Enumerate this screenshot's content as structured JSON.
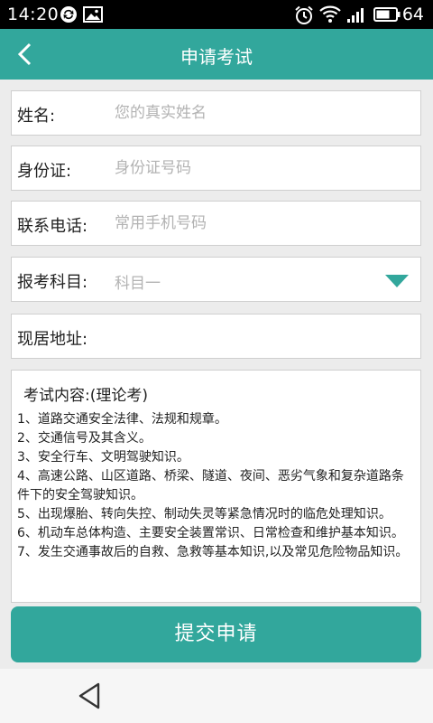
{
  "status_bar": {
    "time": "14:20",
    "battery_percent": "64",
    "icons": [
      "sync-icon",
      "image-icon",
      "alarm-icon",
      "wifi-icon",
      "signal-icon",
      "battery-icon"
    ]
  },
  "app_bar": {
    "title": "申请考试",
    "back_icon": "chevron-left-icon",
    "color": "#32a79c"
  },
  "form": {
    "name": {
      "label": "姓名:",
      "value": "",
      "placeholder": "您的真实姓名"
    },
    "id_card": {
      "label": "身份证:",
      "value": "",
      "placeholder": "身份证号码"
    },
    "phone": {
      "label": "联系电话:",
      "value": "",
      "placeholder": "常用手机号码"
    },
    "subject": {
      "label": "报考科目:",
      "selected": "科目一",
      "icon": "dropdown-triangle-icon"
    },
    "address": {
      "label": "现居地址:",
      "value": "",
      "placeholder": ""
    }
  },
  "exam_content": {
    "heading": "考试内容:(理论考)",
    "items": [
      "1、道路交通安全法律、法规和规章。",
      "2、交通信号及其含义。",
      "3、安全行车、文明驾驶知识。",
      "4、高速公路、山区道路、桥梁、隧道、夜间、恶劣气象和复杂道路条件下的安全驾驶知识。",
      "5、出现爆胎、转向失控、制动失灵等紧急情况时的临危处理知识。",
      "6、机动车总体构造、主要安全装置常识、日常检查和维护基本知识。",
      "7、发生交通事故后的自救、急救等基本知识,以及常见危险物品知识。"
    ]
  },
  "submit_label": "提交申请",
  "nav_bar": {
    "back_icon": "triangle-back-icon"
  }
}
